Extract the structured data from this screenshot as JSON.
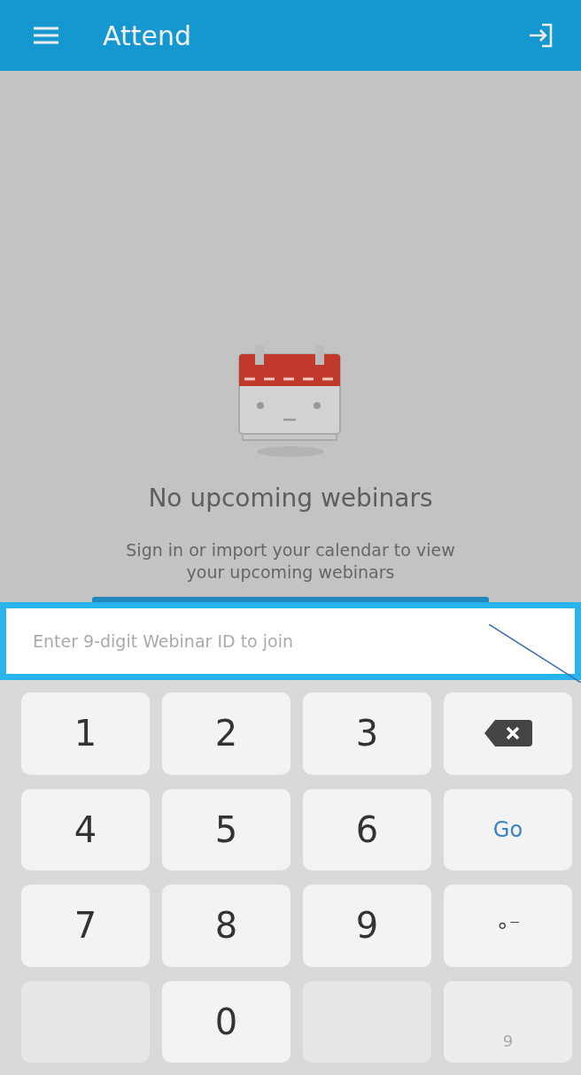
{
  "app_bar": {
    "title": "Attend"
  },
  "empty_state": {
    "title": "No upcoming webinars",
    "message": "Sign in or import your calendar to view your upcoming webinars"
  },
  "webinar_id_field": {
    "placeholder": "Enter 9-digit Webinar ID to join"
  },
  "keypad": [
    {
      "kind": "digit",
      "label": "1"
    },
    {
      "kind": "digit",
      "label": "2"
    },
    {
      "kind": "digit",
      "label": "3"
    },
    {
      "kind": "backspace"
    },
    {
      "kind": "digit",
      "label": "4"
    },
    {
      "kind": "digit",
      "label": "5"
    },
    {
      "kind": "digit",
      "label": "6"
    },
    {
      "kind": "action",
      "label": "Go"
    },
    {
      "kind": "digit",
      "label": "7"
    },
    {
      "kind": "digit",
      "label": "8"
    },
    {
      "kind": "digit",
      "label": "9"
    },
    {
      "kind": "symbol",
      "label": "∘⁻"
    },
    {
      "kind": "blank"
    },
    {
      "kind": "digit",
      "label": "0"
    },
    {
      "kind": "blank"
    },
    {
      "kind": "faded",
      "label": "9"
    }
  ]
}
